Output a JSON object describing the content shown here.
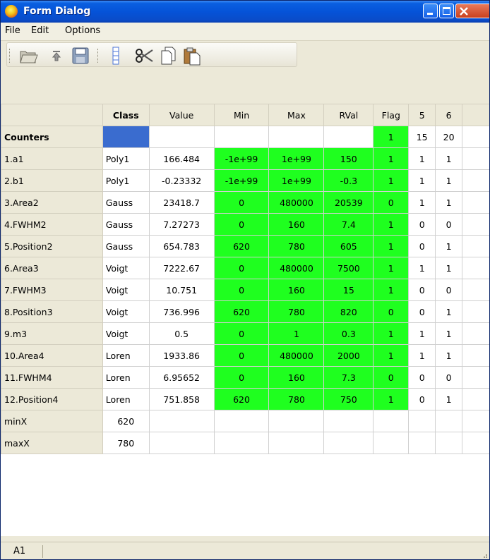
{
  "window": {
    "title": "Form Dialog",
    "title_bar_color": "#0553d8",
    "controls": {
      "minimize": "minimize-icon",
      "maximize": "maximize-icon",
      "close": "close-icon"
    }
  },
  "menu": [
    "File",
    "Edit",
    "Options"
  ],
  "toolbar": [
    "open-folder-icon",
    "upload-icon",
    "save-icon",
    "column-icon",
    "cut-icon",
    "copy-icon",
    "paste-icon"
  ],
  "table": {
    "columns": [
      "",
      "Class",
      "Value",
      "Min",
      "Max",
      "RVal",
      "Flag",
      "5",
      "6",
      ""
    ],
    "rows": [
      {
        "label": "Counters",
        "bold": true,
        "cells": [
          "",
          "",
          "",
          "",
          "",
          "1",
          "15",
          "20",
          ""
        ]
      },
      {
        "label": "1.a1",
        "cells": [
          "Poly1",
          "166.484",
          "-1e+99",
          "1e+99",
          "150",
          "1",
          "1",
          "1",
          ""
        ]
      },
      {
        "label": "2.b1",
        "cells": [
          "Poly1",
          "-0.23332",
          "-1e+99",
          "1e+99",
          "-0.3",
          "1",
          "1",
          "1",
          ""
        ]
      },
      {
        "label": "3.Area2",
        "cells": [
          "Gauss",
          "23418.7",
          "0",
          "480000",
          "20539",
          "0",
          "1",
          "1",
          ""
        ]
      },
      {
        "label": "4.FWHM2",
        "cells": [
          "Gauss",
          "7.27273",
          "0",
          "160",
          "7.4",
          "1",
          "0",
          "0",
          ""
        ]
      },
      {
        "label": "5.Position2",
        "cells": [
          "Gauss",
          "654.783",
          "620",
          "780",
          "605",
          "1",
          "0",
          "1",
          ""
        ]
      },
      {
        "label": "6.Area3",
        "cells": [
          "Voigt",
          "7222.67",
          "0",
          "480000",
          "7500",
          "1",
          "1",
          "1",
          ""
        ]
      },
      {
        "label": "7.FWHM3",
        "cells": [
          "Voigt",
          "10.751",
          "0",
          "160",
          "15",
          "1",
          "0",
          "0",
          ""
        ]
      },
      {
        "label": "8.Position3",
        "cells": [
          "Voigt",
          "736.996",
          "620",
          "780",
          "820",
          "0",
          "0",
          "1",
          ""
        ]
      },
      {
        "label": "9.m3",
        "cells": [
          "Voigt",
          "0.5",
          "0",
          "1",
          "0.3",
          "1",
          "1",
          "1",
          ""
        ]
      },
      {
        "label": "10.Area4",
        "cells": [
          "Loren",
          "1933.86",
          "0",
          "480000",
          "2000",
          "1",
          "1",
          "1",
          ""
        ]
      },
      {
        "label": "11.FWHM4",
        "cells": [
          "Loren",
          "6.95652",
          "0",
          "160",
          "7.3",
          "0",
          "0",
          "0",
          ""
        ]
      },
      {
        "label": "12.Position4",
        "cells": [
          "Loren",
          "751.858",
          "620",
          "780",
          "750",
          "1",
          "0",
          "1",
          ""
        ]
      },
      {
        "label": "minX",
        "cells": [
          "620",
          "",
          "",
          "",
          "",
          "",
          "",
          "",
          ""
        ]
      },
      {
        "label": "maxX",
        "cells": [
          "780",
          "",
          "",
          "",
          "",
          "",
          "",
          "",
          ""
        ]
      }
    ],
    "highlight_color": "#1fff1f",
    "selected_cell_color": "#3a6ccf"
  },
  "status": {
    "cell_ref": "A1"
  }
}
